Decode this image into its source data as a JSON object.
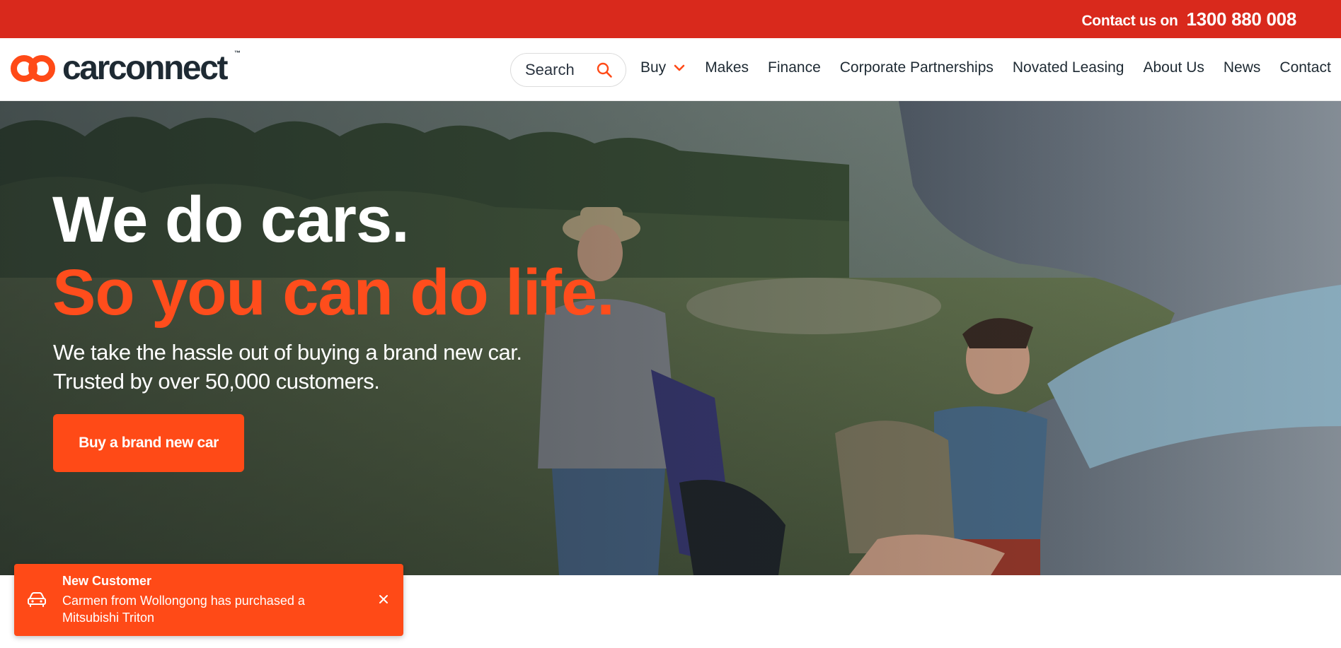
{
  "topbar": {
    "contact_label": "Contact us on",
    "phone": "1300 880 008"
  },
  "header": {
    "logo_text": "carconnect",
    "logo_tm": "™",
    "search_placeholder": "Search",
    "nav": [
      {
        "label": "Buy",
        "icon": "chevron-down-icon"
      },
      {
        "label": "Makes"
      },
      {
        "label": "Finance"
      },
      {
        "label": "Corporate Partnerships"
      },
      {
        "label": "Novated Leasing"
      },
      {
        "label": "About Us"
      },
      {
        "label": "News"
      },
      {
        "label": "Contact"
      }
    ]
  },
  "hero": {
    "headline_1": "We do cars.",
    "headline_2": "So you can do life.",
    "subline_1": "We take the hassle out of buying a brand new car.",
    "subline_2": "Trusted by over 50,000 customers.",
    "cta_label": "Buy a brand new car"
  },
  "toast": {
    "title": "New Customer",
    "message": "Carmen from Wollongong has purchased a Mitsubishi Triton",
    "icon": "car-icon",
    "close_icon": "close-icon"
  },
  "colors": {
    "brand_red": "#d9291c",
    "accent_orange": "#ff4a17",
    "dark_text": "#1e2a33"
  }
}
